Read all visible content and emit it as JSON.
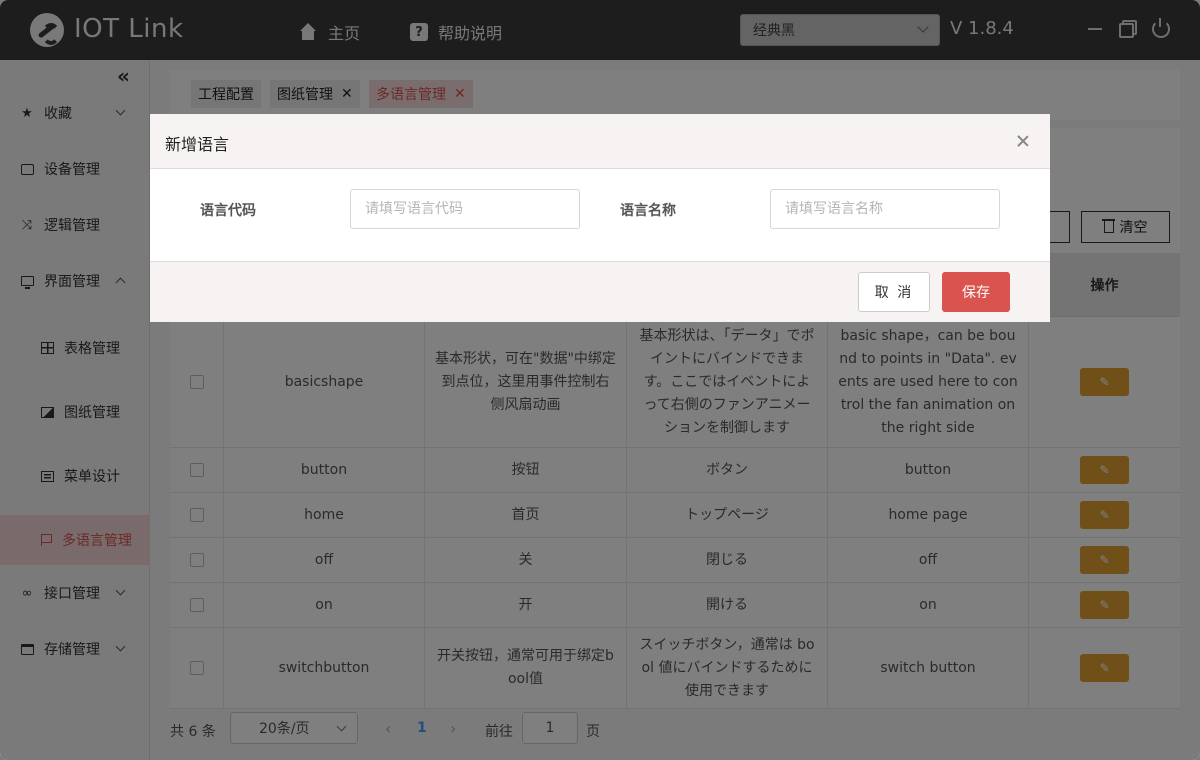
{
  "header": {
    "app_title": "IOT Link",
    "nav": [
      {
        "label": "主页",
        "icon": "home-icon"
      },
      {
        "label": "帮助说明",
        "icon": "help-icon"
      }
    ],
    "theme_select": "经典黑",
    "version": "V 1.8.4"
  },
  "sidebar": {
    "collapse_icon": "«",
    "items": [
      {
        "label": "收藏",
        "icon": "star-icon"
      },
      {
        "label": "设备管理",
        "icon": "device-icon"
      },
      {
        "label": "逻辑管理",
        "icon": "shuffle-icon"
      },
      {
        "label": "界面管理",
        "icon": "monitor-icon"
      },
      {
        "label": "表格管理",
        "icon": "table-icon"
      },
      {
        "label": "图纸管理",
        "icon": "image-icon"
      },
      {
        "label": "菜单设计",
        "icon": "menu-icon"
      },
      {
        "label": "多语言管理",
        "icon": "flag-icon"
      },
      {
        "label": "接口管理",
        "icon": "link-icon"
      },
      {
        "label": "存储管理",
        "icon": "storage-icon"
      }
    ]
  },
  "tabs": [
    {
      "label": "工程配置",
      "closable": false
    },
    {
      "label": "图纸管理",
      "closable": true
    },
    {
      "label": "多语言管理",
      "closable": true,
      "active": true
    }
  ],
  "toolbar": {
    "clear_label": "清空"
  },
  "table": {
    "action_header": "操作",
    "rows": [
      {
        "code": "basicshape",
        "zh": "基本形状，可在\"数据\"中绑定到点位，这里用事件控制右侧风扇动画",
        "ja": "基本形状は、「データ」でポイントにバインドできます。ここではイベントによって右側のファンアニメーションを制御します",
        "en": "basic shape，can be bound to points in \"Data\". events are used here to control the fan animation on the right side"
      },
      {
        "code": "button",
        "zh": "按钮",
        "ja": "ボタン",
        "en": "button"
      },
      {
        "code": "home",
        "zh": "首页",
        "ja": "トップページ",
        "en": "home page"
      },
      {
        "code": "off",
        "zh": "关",
        "ja": "閉じる",
        "en": "off"
      },
      {
        "code": "on",
        "zh": "开",
        "ja": "開ける",
        "en": "on"
      },
      {
        "code": "switchbutton",
        "zh": "开关按钮，通常可用于绑定bool值",
        "ja": "スイッチボタン，通常は bool 値にバインドするために使用できます",
        "en": "switch button"
      }
    ]
  },
  "pagination": {
    "total": "共 6 条",
    "page_size": "20条/页",
    "prev": "‹",
    "current": "1",
    "next": "›",
    "goto_label": "前往",
    "goto_value": "1",
    "page_label": "页"
  },
  "dialog": {
    "title": "新增语言",
    "code_label": "语言代码",
    "code_placeholder": "请填写语言代码",
    "name_label": "语言名称",
    "name_placeholder": "请填写语言名称",
    "cancel_label": "取 消",
    "save_label": "保存"
  },
  "colors": {
    "header_bg": "#3a3a3a",
    "accent": "#d9534f",
    "edit_button": "#e0a030",
    "pager_active": "#409eff"
  }
}
